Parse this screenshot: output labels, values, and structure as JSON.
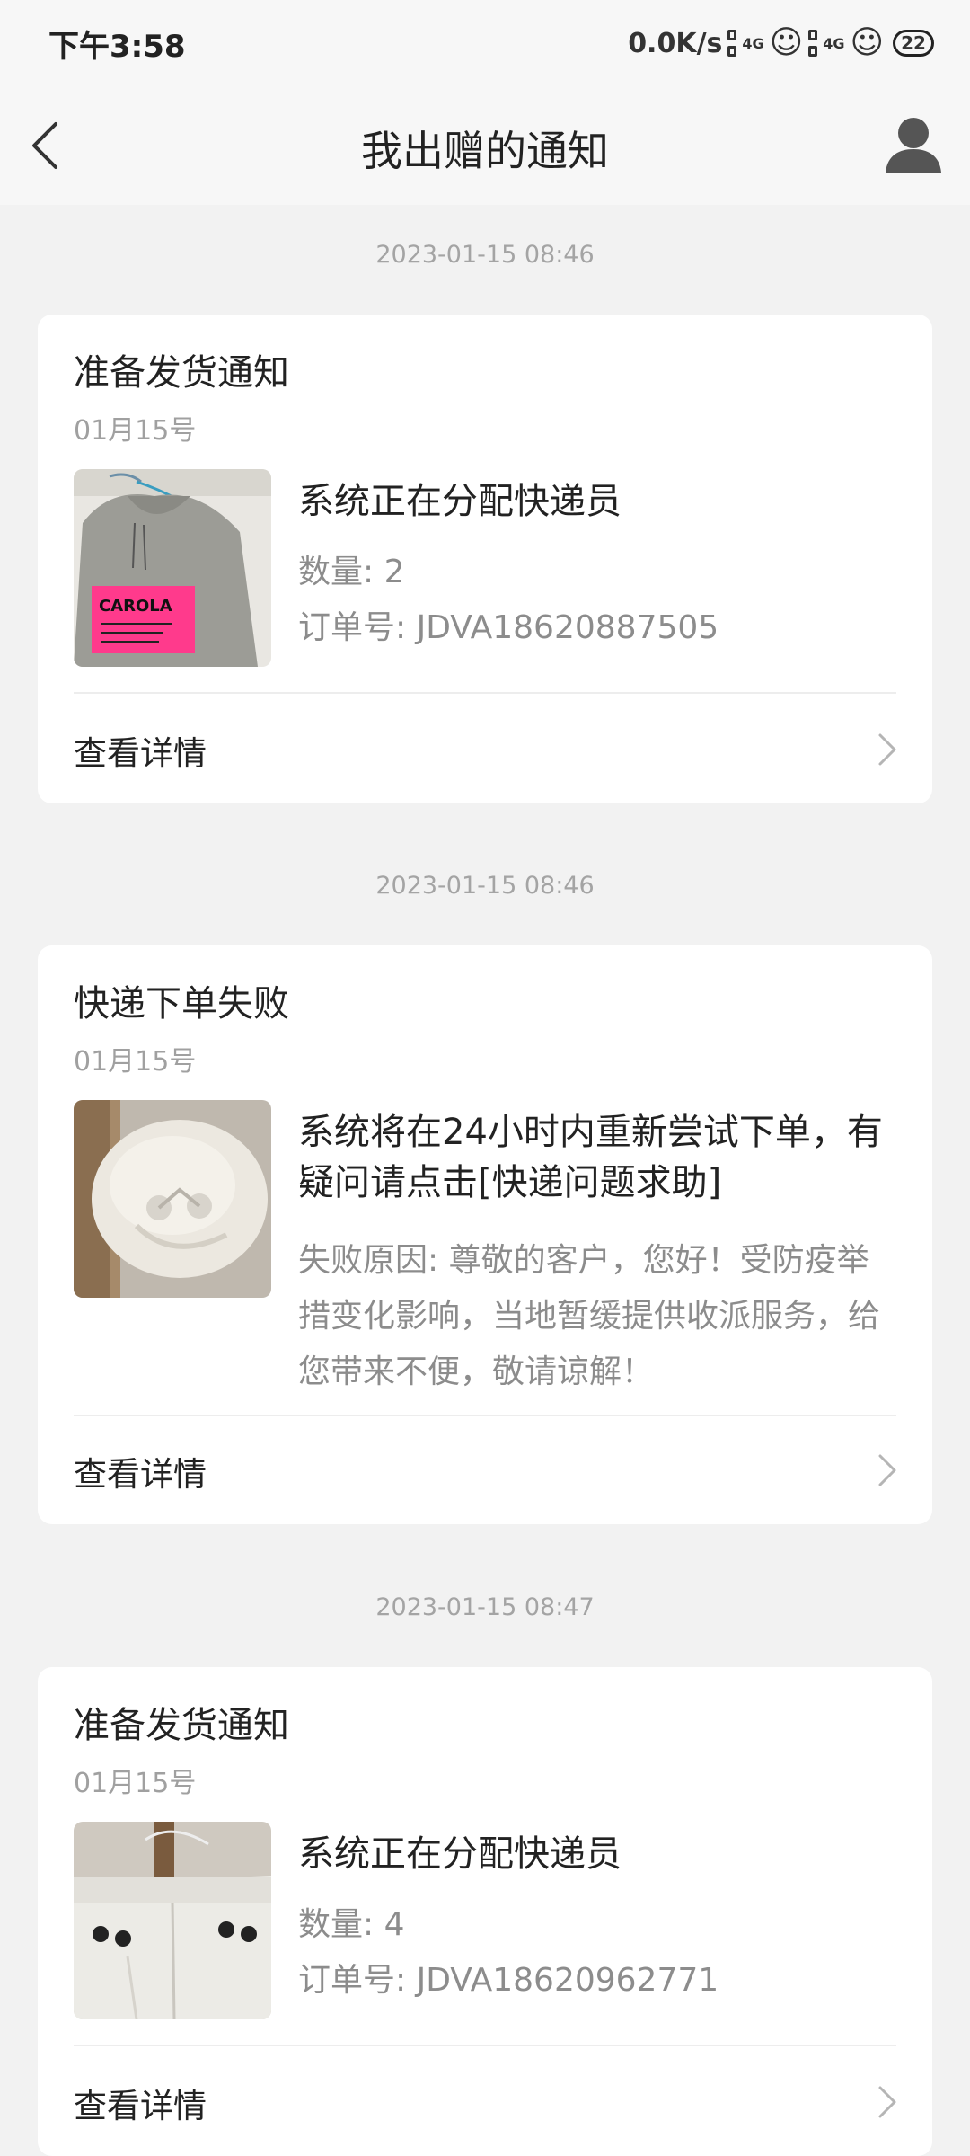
{
  "status_bar": {
    "time": "下午3:58",
    "net_speed": "0.0K/s",
    "signal_label": "4G",
    "battery": "22",
    "face_glyph": "☺"
  },
  "nav": {
    "title": "我出赠的通知",
    "back_icon": "back-arrow-icon",
    "profile_icon": "user-icon"
  },
  "notifications": [
    {
      "timestamp": "2023-01-15 08:46",
      "title": "准备发货通知",
      "date": "01月15号",
      "image": "grey-hoodie-photo",
      "main_text": "系统正在分配快递员",
      "quantity": "数量: 2",
      "order_no": "订单号: JDVA18620887505",
      "detail_label": "查看详情"
    },
    {
      "timestamp": "2023-01-15 08:46",
      "title": "快递下单失败",
      "date": "01月15号",
      "image": "white-fleece-cap-photo",
      "main_text": "系统将在24小时内重新尝试下单，有疑问请点击[快递问题求助]",
      "reason": "失败原因: 尊敬的客户，您好！受防疫举措变化影响，当地暂缓提供收派服务，给您带来不便，敬请谅解！",
      "detail_label": "查看详情"
    },
    {
      "timestamp": "2023-01-15 08:47",
      "title": "准备发货通知",
      "date": "01月15号",
      "image": "white-pants-photo",
      "main_text": "系统正在分配快递员",
      "quantity": "数量: 4",
      "order_no": "订单号: JDVA18620962771",
      "detail_label": "查看详情"
    }
  ],
  "colors": {
    "background": "#f2f2f2",
    "card": "#ffffff",
    "muted_text": "#a0a0a0",
    "hoodie_print": "#ff3a8c"
  }
}
